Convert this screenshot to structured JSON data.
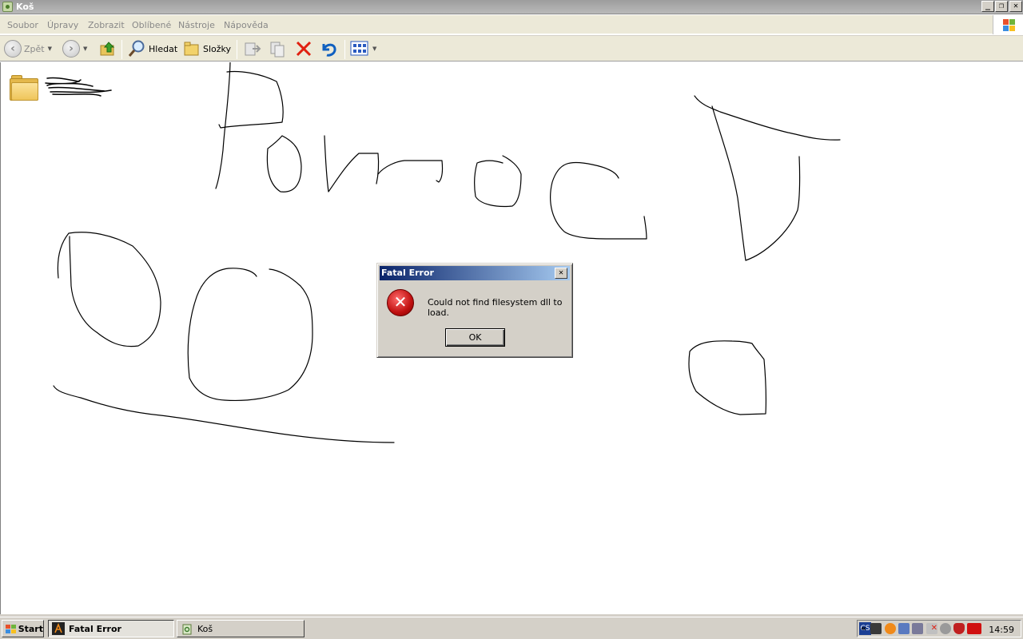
{
  "window": {
    "title": "Koš",
    "buttons": {
      "minimize": "_",
      "restore": "❐",
      "close": "✕"
    }
  },
  "menu": {
    "items": [
      "Soubor",
      "Úpravy",
      "Zobrazit",
      "Oblíbené",
      "Nástroje",
      "Nápověda"
    ]
  },
  "toolbar": {
    "back_label": "Zpět",
    "search_label": "Hledat",
    "folders_label": "Složky"
  },
  "dialog": {
    "title": "Fatal Error",
    "message": "Could not find filesystem dll to load.",
    "ok_label": "OK",
    "close_glyph": "✕",
    "icon_glyph": "✕"
  },
  "taskbar": {
    "start_label": "Start",
    "tasks": [
      {
        "label": "Fatal Error",
        "active": true
      },
      {
        "label": "Koš",
        "active": false
      }
    ],
    "language": "CS",
    "tray_expand": "«",
    "clock": "14:59"
  },
  "colors": {
    "dialog_title_start": "#0a246a",
    "dialog_title_end": "#a6caf0",
    "error_red": "#c01010",
    "delete_red": "#e02010",
    "undo_blue": "#1060c0"
  }
}
